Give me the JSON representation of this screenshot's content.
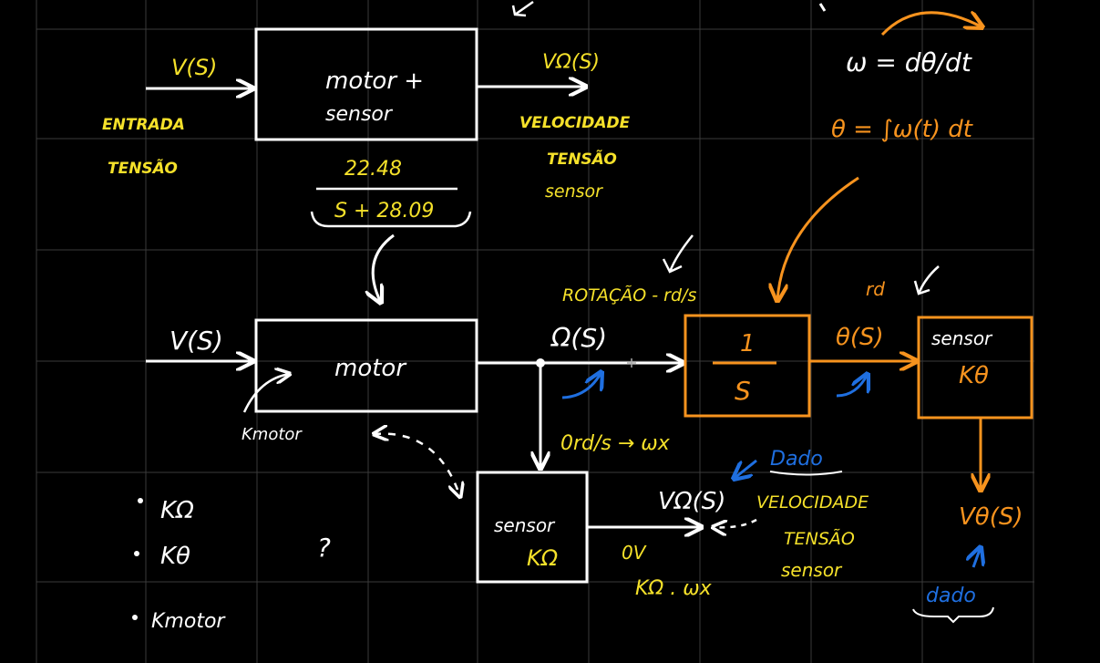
{
  "colors": {
    "background": "#000000",
    "grid": "#3a3a3a",
    "white": "#ffffff",
    "yellow": "#f5e12a",
    "orange": "#f7931e",
    "blue": "#1f6fe0"
  },
  "top": {
    "input_signal": "V(S)",
    "input_label_1": "ENTRADA",
    "input_label_2": "TENSÃO",
    "block_line_1": "motor +",
    "block_line_2": "sensor",
    "output_signal": "VΩ(S)",
    "output_label_1": "VELOCIDADE",
    "output_label_2": "TENSÃO",
    "output_label_3": "sensor",
    "tf_numerator": "22.48",
    "tf_denominator": "S + 28.09"
  },
  "formulas": {
    "omega_def": "ω = dθ/dt",
    "theta_int": "θ = ∫ω(t) dt"
  },
  "middle": {
    "input_signal": "V(S)",
    "motor_block": "motor",
    "motor_gain_label": "Kmotor",
    "rotation_label": "ROTAÇÃO - rd/s",
    "omega_signal": "Ω(S)",
    "integrator_num": "1",
    "integrator_den": "S",
    "theta_signal": "θ(S)",
    "rd_label": "rd",
    "theta_sensor_1": "sensor",
    "theta_sensor_2": "Kθ"
  },
  "bottom": {
    "omega_note": "0rd/s → ωx",
    "omega_sensor_1": "sensor",
    "omega_sensor_2": "KΩ",
    "sensor_out_signal": "VΩ(S)",
    "zero_volt": "0V",
    "product": "KΩ . ωx",
    "vel_label_1": "VELOCIDADE",
    "vel_label_2": "TENSÃO",
    "vel_label_3": "sensor",
    "dado_1": "Dado",
    "theta_out_signal": "Vθ(S)",
    "dado_2": "dado"
  },
  "list": {
    "item_1": "KΩ",
    "item_2": "Kθ",
    "item_3": "Kmotor",
    "question": "?"
  }
}
